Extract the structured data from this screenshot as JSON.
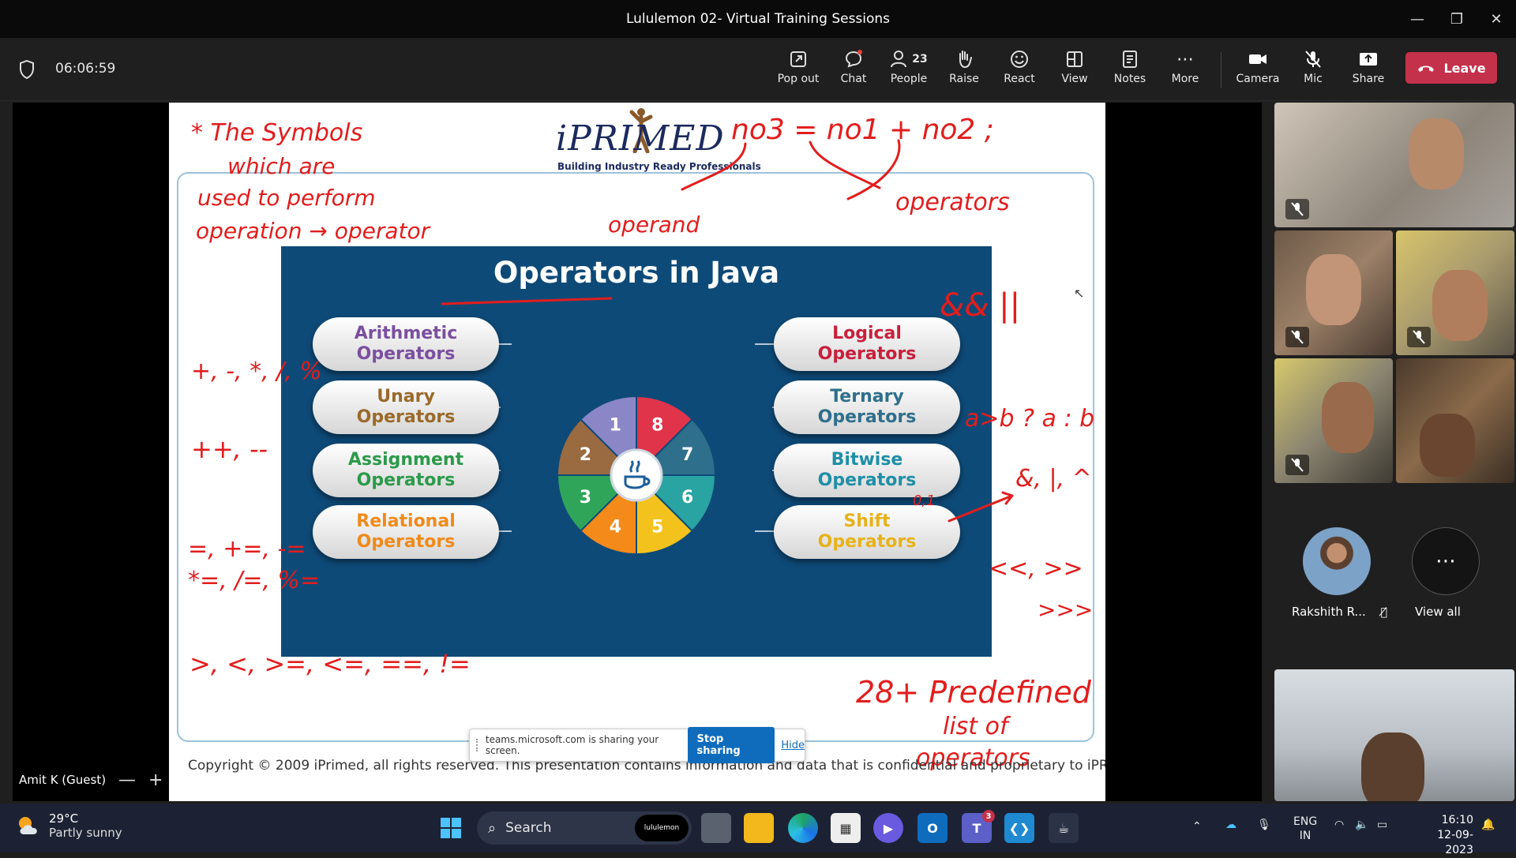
{
  "window": {
    "title": "Lululemon 02- Virtual Training Sessions"
  },
  "meeting": {
    "timer": "06:06:59",
    "toolbar": [
      {
        "label": "Pop out",
        "icon": "pop-out-icon"
      },
      {
        "label": "Chat",
        "icon": "chat-icon"
      },
      {
        "label": "People",
        "icon": "people-icon",
        "count": "23"
      },
      {
        "label": "Raise",
        "icon": "raise-hand-icon"
      },
      {
        "label": "React",
        "icon": "react-icon"
      },
      {
        "label": "View",
        "icon": "view-icon"
      },
      {
        "label": "Notes",
        "icon": "notes-icon"
      },
      {
        "label": "More",
        "icon": "more-icon"
      },
      {
        "label": "Camera",
        "icon": "camera-icon"
      },
      {
        "label": "Mic",
        "icon": "mic-off-icon"
      },
      {
        "label": "Share",
        "icon": "share-icon"
      }
    ],
    "leave_label": "Leave"
  },
  "slide": {
    "logo_name": "iPRIMED",
    "logo_tagline": "Building Industry Ready Professionals",
    "title": "Operators in Java",
    "left_pills": [
      {
        "line1": "Arithmetic",
        "line2": "Operators",
        "color": "#7b4fa0"
      },
      {
        "line1": "Unary",
        "line2": "Operators",
        "color": "#9a6a2a"
      },
      {
        "line1": "Assignment",
        "line2": "Operators",
        "color": "#2c9a4a"
      },
      {
        "line1": "Relational",
        "line2": "Operators",
        "color": "#f08a1a"
      }
    ],
    "right_pills": [
      {
        "line1": "Logical",
        "line2": "Operators",
        "color": "#c8203c"
      },
      {
        "line1": "Ternary",
        "line2": "Operators",
        "color": "#2e6f8c"
      },
      {
        "line1": "Bitwise",
        "line2": "Operators",
        "color": "#1f8fa6"
      },
      {
        "line1": "Shift",
        "line2": "Operators",
        "color": "#e7b21a"
      }
    ],
    "wheel_numbers": [
      "1",
      "8",
      "7",
      "6",
      "5",
      "4",
      "3",
      "2"
    ],
    "wheel_colors": [
      "#8b86c6",
      "#e0344a",
      "#2e6f8c",
      "#2aa3a3",
      "#f4c21c",
      "#f48a1a",
      "#2fa55a",
      "#9a6a40"
    ],
    "copyright": "Copyright © 2009 iPrimed, all rights reserved. This presentation contains information  and data  that is confidential and proprietary to iPRIMED.",
    "annotations": {
      "top_left": [
        "* The Symbols",
        "which are",
        "used to perform",
        "operation → operator"
      ],
      "equation": "no3 = no1 + no2 ;",
      "operand": "operand",
      "operators": "operators",
      "logical": "&&  ||",
      "arith": "+, -, *, /, %",
      "unary": "++, --",
      "assign1": "=, +=, -=",
      "assign2": "*=, /=, %=",
      "relational": ">, <, >=, <=, ==, !=",
      "ternary": "a>b ? a : b",
      "bitwise_bits": "0,1",
      "bitwise": "&, |, ^",
      "shift1": "<<, >>",
      "shift2": ">>>",
      "predef": [
        "28+ Predefined",
        "list of",
        "operators"
      ]
    }
  },
  "sharebar": {
    "text": "teams.microsoft.com is sharing your screen.",
    "stop_label": "Stop sharing",
    "hide_label": "Hide"
  },
  "presenter": {
    "name": "Amit K (Guest)",
    "zoom_out": "—",
    "zoom_in": "+"
  },
  "participants": {
    "named": "Rakshith R...",
    "view_all": "View all"
  },
  "taskbar": {
    "temp": "29°C",
    "weather": "Partly sunny",
    "search_label": "Search",
    "search_badge": "lululemon",
    "teams_badge": "3",
    "lang1": "ENG",
    "lang2": "IN",
    "time": "16:10",
    "date": "12-09-2023"
  }
}
